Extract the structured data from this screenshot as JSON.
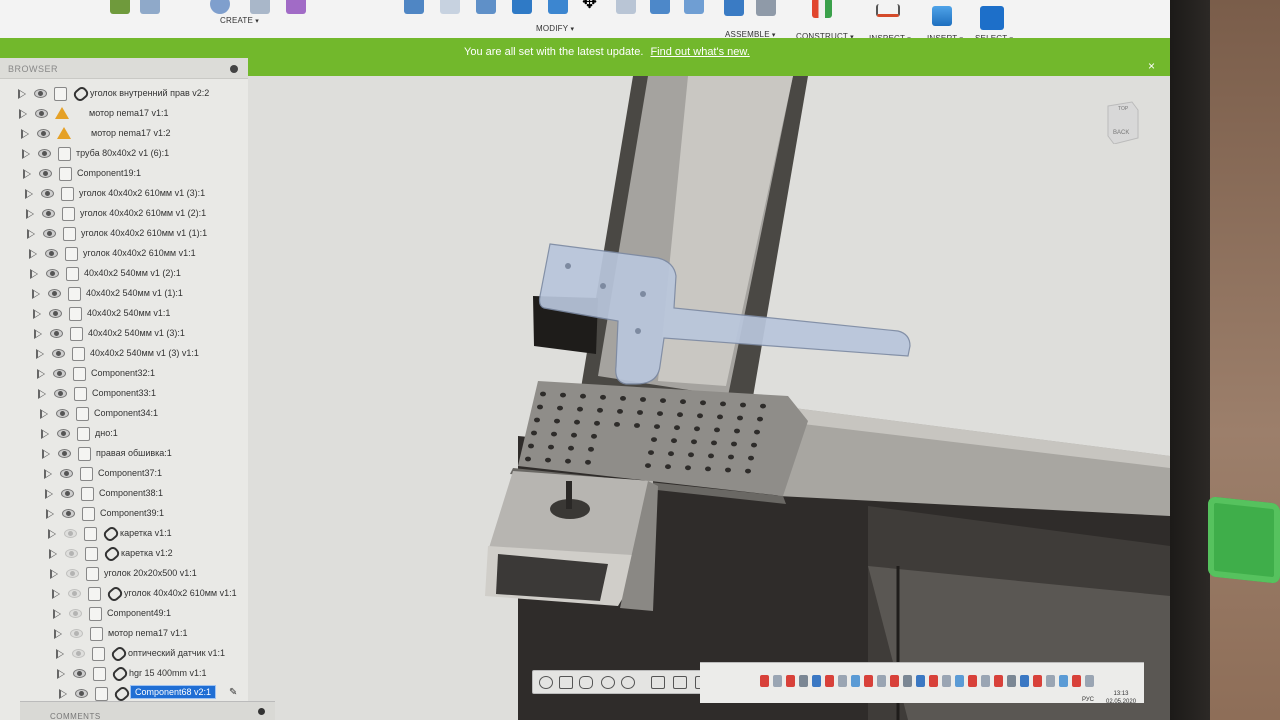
{
  "toolbar": {
    "groups": [
      {
        "label": "CREATE"
      },
      {
        "label": "MODIFY"
      },
      {
        "label": "ASSEMBLE"
      },
      {
        "label": "CONSTRUCT"
      },
      {
        "label": "INSPECT"
      },
      {
        "label": "INSERT"
      },
      {
        "label": "SELECT"
      }
    ]
  },
  "update_bar": {
    "message": "You are all set with the latest update.",
    "link": "Find out what's new.",
    "close": "×"
  },
  "browser": {
    "title": "BROWSER",
    "items": [
      {
        "label": "уголок внутренний прав v2:2",
        "icon": "component-icon",
        "linked": true,
        "visible": true
      },
      {
        "label": "мотор nema17 v1:1",
        "icon": "warning-icon",
        "linked": false,
        "visible": true
      },
      {
        "label": "мотор nema17 v1:2",
        "icon": "warning-icon",
        "linked": false,
        "visible": true
      },
      {
        "label": "труба 80x40x2 v1 (6):1",
        "icon": "component-icon",
        "linked": false,
        "visible": true
      },
      {
        "label": "Component19:1",
        "icon": "component-icon",
        "linked": false,
        "visible": true
      },
      {
        "label": "уголок 40x40x2  610мм v1 (3):1",
        "icon": "component-icon",
        "linked": false,
        "visible": true
      },
      {
        "label": "уголок 40x40x2  610мм v1 (2):1",
        "icon": "component-icon",
        "linked": false,
        "visible": true
      },
      {
        "label": "уголок 40x40x2  610мм v1 (1):1",
        "icon": "component-icon",
        "linked": false,
        "visible": true
      },
      {
        "label": "уголок 40x40x2  610мм v1:1",
        "icon": "component-icon",
        "linked": false,
        "visible": true
      },
      {
        "label": "40x40x2  540мм v1 (2):1",
        "icon": "component-icon",
        "linked": false,
        "visible": true
      },
      {
        "label": "40x40x2  540мм v1 (1):1",
        "icon": "component-icon",
        "linked": false,
        "visible": true
      },
      {
        "label": "40x40x2  540мм v1:1",
        "icon": "component-icon",
        "linked": false,
        "visible": true
      },
      {
        "label": "40x40x2  540мм v1 (3):1",
        "icon": "component-icon",
        "linked": false,
        "visible": true
      },
      {
        "label": "40x40x2  540мм v1 (3) v1:1",
        "icon": "component-icon",
        "linked": false,
        "visible": true
      },
      {
        "label": "Component32:1",
        "icon": "component-icon",
        "linked": false,
        "visible": true
      },
      {
        "label": "Component33:1",
        "icon": "component-icon",
        "linked": false,
        "visible": true
      },
      {
        "label": "Component34:1",
        "icon": "component-icon",
        "linked": false,
        "visible": true
      },
      {
        "label": "дно:1",
        "icon": "component-icon",
        "linked": false,
        "visible": true
      },
      {
        "label": "правая обшивка:1",
        "icon": "component-icon",
        "linked": false,
        "visible": true
      },
      {
        "label": "Component37:1",
        "icon": "component-icon",
        "linked": false,
        "visible": true
      },
      {
        "label": "Component38:1",
        "icon": "component-icon",
        "linked": false,
        "visible": true
      },
      {
        "label": "Component39:1",
        "icon": "component-icon",
        "linked": false,
        "visible": true
      },
      {
        "label": "каретка v1:1",
        "icon": "component-icon",
        "linked": true,
        "visible": false
      },
      {
        "label": "каретка v1:2",
        "icon": "component-icon",
        "linked": true,
        "visible": false
      },
      {
        "label": "уголок 20x20x500 v1:1",
        "icon": "component-icon",
        "linked": false,
        "visible": false
      },
      {
        "label": "уголок 40x40x2  610мм v1:1",
        "icon": "component-icon",
        "linked": true,
        "visible": false
      },
      {
        "label": "Component49:1",
        "icon": "component-icon",
        "linked": false,
        "visible": false
      },
      {
        "label": "мотор nema17 v1:1",
        "icon": "component-icon",
        "linked": false,
        "visible": false
      },
      {
        "label": "оптический датчик v1:1",
        "icon": "component-icon",
        "linked": true,
        "visible": false
      },
      {
        "label": "hgr 15  400mm v1:1",
        "icon": "component-icon",
        "linked": true,
        "visible": true
      },
      {
        "label": "Component68 v2:1",
        "icon": "component-icon",
        "linked": true,
        "visible": true,
        "selected": true
      }
    ]
  },
  "comments": {
    "label": "COMMENTS"
  },
  "viewcube": {
    "top": "TOP",
    "back": "BACK"
  },
  "taskbar": {
    "language": "РУС",
    "time": "13:13",
    "date": "02.05.2020"
  },
  "colors": {
    "update_bar": "#72b82c",
    "selection": "#1f6ed4",
    "part_highlight": "#b9c6dc"
  }
}
